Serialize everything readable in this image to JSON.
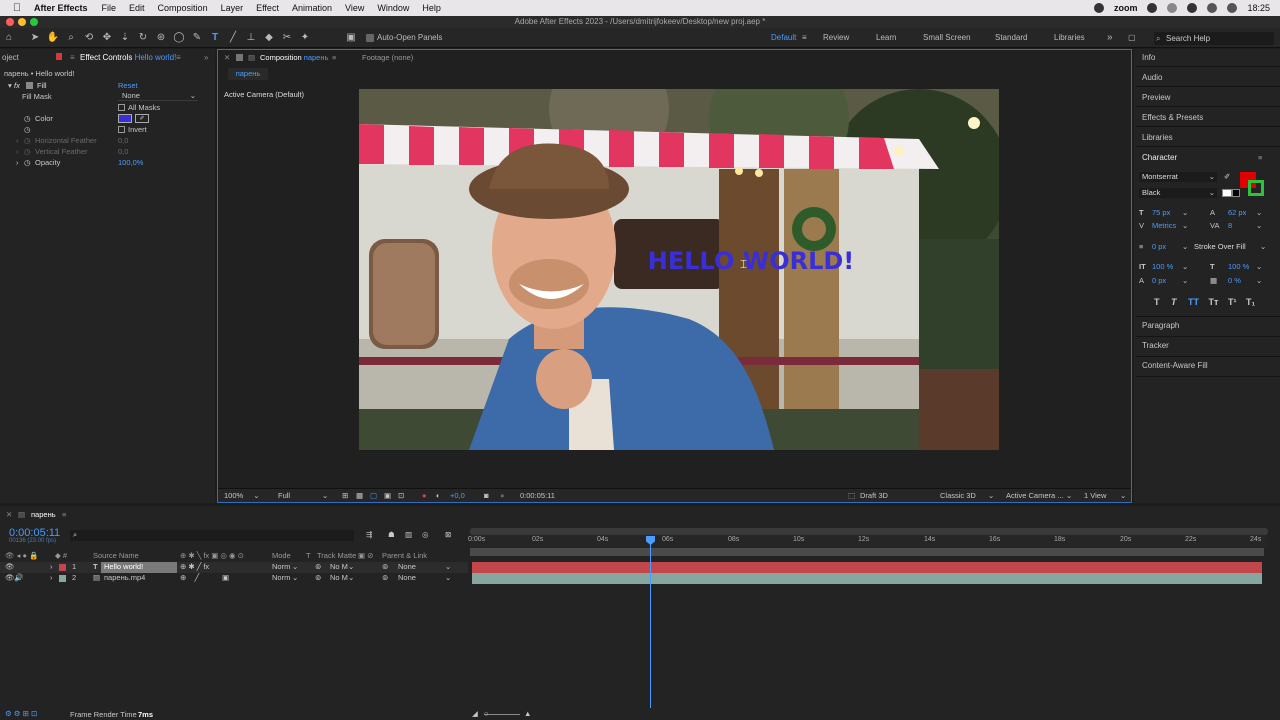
{
  "menubar": {
    "app_name": "After Effects",
    "items": [
      "File",
      "Edit",
      "Composition",
      "Layer",
      "Effect",
      "Animation",
      "View",
      "Window",
      "Help"
    ],
    "zoom_label": "zoom",
    "time": "18:25"
  },
  "window": {
    "title": "Adobe After Effects 2023 - /Users/dmitrijfokeev/Desktop/new proj.aep *"
  },
  "toolbar": {
    "auto_open_panels": "Auto-Open Panels",
    "workspaces": [
      "Default",
      "Review",
      "Learn",
      "Small Screen",
      "Standard",
      "Libraries"
    ],
    "active_workspace": "Default",
    "search_placeholder": "Search Help"
  },
  "effect_controls": {
    "project_tab": "oject",
    "tab_label": "Effect Controls",
    "tab_layer": "Hello world!",
    "layer_path": "парень • Hello world!",
    "effect_name": "Fill",
    "reset_label": "Reset",
    "fill_mask_label": "Fill Mask",
    "fill_mask_value": "None",
    "all_masks_label": "All Masks",
    "color_label": "Color",
    "color_value": "#3a2fd6",
    "invert_label": "Invert",
    "h_feather_label": "Horizontal Feather",
    "h_feather_value": "0,0",
    "v_feather_label": "Vertical Feather",
    "v_feather_value": "0,0",
    "opacity_label": "Opacity",
    "opacity_value": "100,0%"
  },
  "composition": {
    "tab_label": "Composition",
    "tab_comp": "парень",
    "footage_tab": "Footage (none)",
    "comp_button": "парень",
    "camera_label": "Active Camera (Default)",
    "overlay_text": "HELLO WORLD!",
    "zoom": "100%",
    "resolution": "Full",
    "exposure": "+0,0",
    "timecode": "0:00:05:11",
    "draft3d": "Draft 3D",
    "renderer": "Classic 3D",
    "camera_select": "Active Camera ...",
    "views": "1 View"
  },
  "right_panel": {
    "items_top": [
      "Info",
      "Audio",
      "Preview",
      "Effects & Presets",
      "Libraries"
    ],
    "character_title": "Character",
    "font_family": "Montserrat",
    "font_style": "Black",
    "fill_color": "#e00000",
    "stroke_color": "#2ec23a",
    "font_size": "75 px",
    "leading": "62 px",
    "kerning": "Metrics",
    "tracking": "8",
    "stroke_width": "0 px",
    "stroke_mode": "Stroke Over Fill",
    "vert_scale": "100 %",
    "horiz_scale": "100 %",
    "baseline": "0 px",
    "tsume": "0 %",
    "items_bottom": [
      "Paragraph",
      "Tracker",
      "Content-Aware Fill"
    ]
  },
  "timeline": {
    "tab_label": "парень",
    "current_time": "0:00:05:11",
    "frame_info": "00136 (23.00 fps)",
    "col_source": "Source Name",
    "col_mode": "Mode",
    "col_t": "T",
    "col_trackmatte": "Track Matte",
    "col_parent": "Parent & Link",
    "layers": [
      {
        "num": "1",
        "name": "Hello world!",
        "mode": "Norm",
        "matte": "No M",
        "parent": "None",
        "color": "#c2474a"
      },
      {
        "num": "2",
        "name": "парень.mp4",
        "mode": "Norm",
        "matte": "No M",
        "parent": "None",
        "color": "#86a6a0"
      }
    ],
    "ruler": [
      "0:00s",
      "02s",
      "04s",
      "06s",
      "08s",
      "10s",
      "12s",
      "14s",
      "16s",
      "18s",
      "20s",
      "22s",
      "24s"
    ],
    "render_time_label": "Frame Render Time",
    "render_time_value": "7ms"
  }
}
